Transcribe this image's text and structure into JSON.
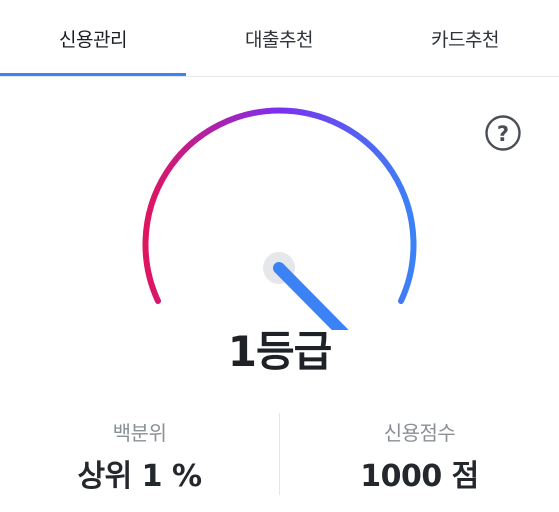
{
  "tabs": [
    {
      "label": "신용관리",
      "active": true
    },
    {
      "label": "대출추천",
      "active": false
    },
    {
      "label": "카드추천",
      "active": false
    }
  ],
  "help": {
    "icon": "question-circle-icon",
    "glyph": "?"
  },
  "gauge": {
    "gradient_start": "#e0155f",
    "gradient_mid": "#7c2ff0",
    "gradient_end": "#3b82f6",
    "needle_color": "#3b82f6",
    "pivot_color": "#e6e7ea",
    "level": 0.97
  },
  "grade_label": "1등급",
  "stats": [
    {
      "label": "백분위",
      "value": "상위 1 %"
    },
    {
      "label": "신용점수",
      "value": "1000 점"
    }
  ],
  "accent_color": "#3b82f6"
}
